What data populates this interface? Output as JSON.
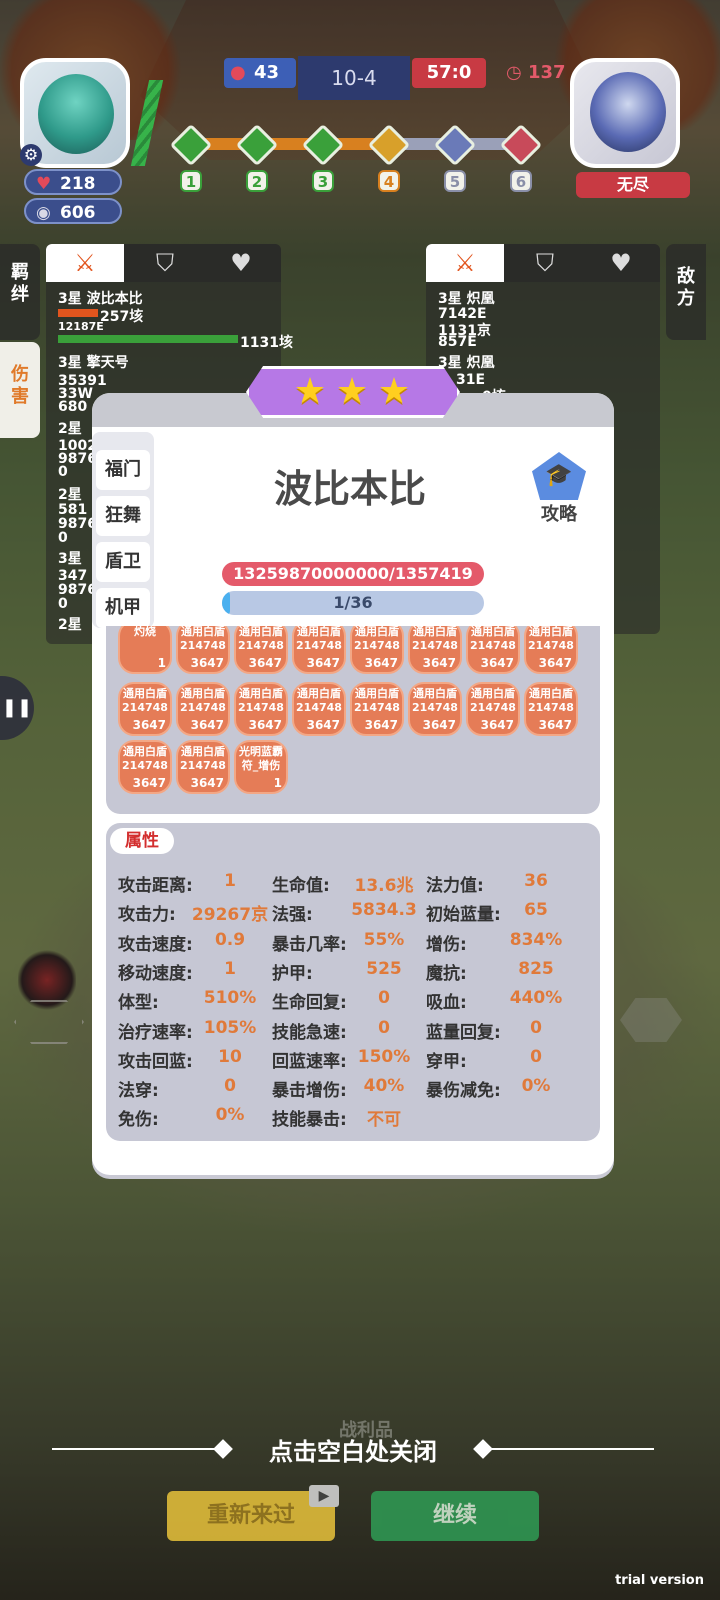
{
  "hud": {
    "player_hearts": "218",
    "player_coins": "606",
    "score_left": "43",
    "stage": "10-4",
    "score_right": "57:0",
    "timer": "137",
    "enemy_label": "无尽",
    "stage_nodes": [
      "1",
      "2",
      "3",
      "4",
      "5",
      "6"
    ]
  },
  "left_panel": {
    "side_tab_top": "羁绊",
    "side_tab_bottom": "伤害",
    "lines": [
      "3星 波比本比",
      "257垓",
      "12187E",
      "1131垓",
      "3星 擎天号",
      "35391",
      "33W",
      "680",
      "2星",
      "1002",
      "9876",
      "0",
      "2星",
      "581",
      "9876",
      "0",
      "3星",
      "347",
      "9876",
      "0",
      "2星"
    ]
  },
  "right_panel": {
    "side_tab": "敌方",
    "lines": [
      "3星 炽凰",
      "7142E",
      "1131京",
      "857E",
      "3星 炽凰",
      "31E",
      "0垓"
    ]
  },
  "modal": {
    "stars": 3,
    "side_tabs": [
      "福门",
      "狂舞",
      "盾卫",
      "机甲"
    ],
    "hero_name": "波比本比",
    "guide_label": "攻略",
    "hp_text": "13259870000000/1357419",
    "mp_text": "1/36",
    "mp_fraction": 0.028,
    "buffs": [
      {
        "name": "灼烧",
        "count": "1"
      },
      {
        "name": "通用白盾",
        "value": "214748",
        "count": "3647"
      },
      {
        "name": "通用白盾",
        "value": "214748",
        "count": "3647"
      },
      {
        "name": "通用白盾",
        "value": "214748",
        "count": "3647"
      },
      {
        "name": "通用白盾",
        "value": "214748",
        "count": "3647"
      },
      {
        "name": "通用白盾",
        "value": "214748",
        "count": "3647"
      },
      {
        "name": "通用白盾",
        "value": "214748",
        "count": "3647"
      },
      {
        "name": "通用白盾",
        "value": "214748",
        "count": "3647"
      },
      {
        "name": "通用白盾",
        "value": "214748",
        "count": "3647"
      },
      {
        "name": "通用白盾",
        "value": "214748",
        "count": "3647"
      },
      {
        "name": "通用白盾",
        "value": "214748",
        "count": "3647"
      },
      {
        "name": "通用白盾",
        "value": "214748",
        "count": "3647"
      },
      {
        "name": "通用白盾",
        "value": "214748",
        "count": "3647"
      },
      {
        "name": "通用白盾",
        "value": "214748",
        "count": "3647"
      },
      {
        "name": "通用白盾",
        "value": "214748",
        "count": "3647"
      },
      {
        "name": "通用白盾",
        "value": "214748",
        "count": "3647"
      },
      {
        "name": "通用白盾",
        "value": "214748",
        "count": "3647"
      },
      {
        "name": "通用白盾",
        "value": "214748",
        "count": "3647"
      },
      {
        "name": "光明蓝霸符_增伤",
        "count": "1"
      }
    ],
    "attr_title": "属性",
    "attributes": [
      [
        "攻击距离:",
        "1",
        "生命值:",
        "13.6兆",
        "法力值:",
        "36"
      ],
      [
        "攻击力:",
        "29267京",
        "法强:",
        "5834.3",
        "初始蓝量:",
        "65"
      ],
      [
        "攻击速度:",
        "0.9",
        "暴击几率:",
        "55%",
        "增伤:",
        "834%"
      ],
      [
        "移动速度:",
        "1",
        "护甲:",
        "525",
        "魔抗:",
        "825"
      ],
      [
        "体型:",
        "510%",
        "生命回复:",
        "0",
        "吸血:",
        "440%"
      ],
      [
        "治疗速率:",
        "105%",
        "技能急速:",
        "0",
        "蓝量回复:",
        "0"
      ],
      [
        "攻击回蓝:",
        "10",
        "回蓝速率:",
        "150%",
        "穿甲:",
        "0"
      ],
      [
        "法穿:",
        "0",
        "暴击增伤:",
        "40%",
        "暴伤减免:",
        "0%"
      ],
      [
        "免伤:",
        "0%",
        "技能暴击:",
        "不可",
        "",
        ""
      ]
    ]
  },
  "bottom": {
    "close_hint": "点击空白处关闭",
    "behind_label": "战利品",
    "retry_label": "重新来过",
    "continue_label": "继续"
  },
  "watermark": "trial version",
  "colors": {
    "accent_purple": "#b678e6",
    "hp_red": "#e45a6a",
    "buff_orange": "#e57c57",
    "attr_value": "#e07a3a",
    "continue_green": "#2f9c55",
    "retry_yellow": "#e9c33b"
  }
}
